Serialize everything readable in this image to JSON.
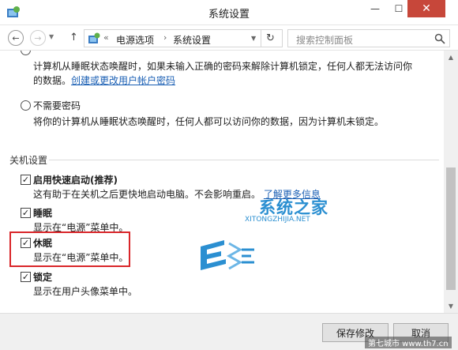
{
  "window": {
    "title": "系统设置",
    "minimize_glyph": "—",
    "maximize_glyph": "☐",
    "close_glyph": "✕"
  },
  "nav": {
    "back_glyph": "←",
    "forward_glyph": "→",
    "up_glyph": "↑",
    "breadcrumb_prefix": "«",
    "breadcrumb": [
      "电源选项",
      "系统设置"
    ],
    "breadcrumb_sep": "›",
    "refresh_glyph": "↻",
    "search_placeholder": "搜索控制面板"
  },
  "password_options": {
    "require_desc_line1": "计算机从睡眠状态唤醒时，如果未输入正确的密码来解除计算机锁定，任何人都无法访问你",
    "require_desc_line2_prefix": "的数据。",
    "require_link": "创建或更改用户帐户密码",
    "no_password_label": "不需要密码",
    "no_password_desc": "将你的计算机从睡眠状态唤醒时，任何人都可以访问你的数据，因为计算机未锁定。"
  },
  "shutdown_settings": {
    "group_label": "关机设置",
    "check_glyph": "✓",
    "items": [
      {
        "label": "启用快速启动(推荐)",
        "desc": "这有助于在关机之后更快地启动电脑。不会影响重启。",
        "link": "了解更多信息",
        "checked": true
      },
      {
        "label": "睡眠",
        "desc": "显示在“电源”菜单中。",
        "checked": true
      },
      {
        "label": "休眠",
        "desc": "显示在“电源”菜单中。",
        "checked": true
      },
      {
        "label": "锁定",
        "desc": "显示在用户头像菜单中。",
        "checked": true
      }
    ]
  },
  "buttons": {
    "save": "保存修改",
    "cancel": "取消"
  },
  "scrollbar": {
    "up_glyph": "▲",
    "down_glyph": "▼"
  },
  "watermark": {
    "name": "系统之家",
    "url": "XITONGZHIJIA.NET",
    "corner": "第七城市 www.th7.cn"
  },
  "colors": {
    "accent_link": "#1a5fb4",
    "highlight_red": "#d9262a",
    "watermark_blue": "#2b8fd1",
    "close_red": "#c7473a"
  }
}
